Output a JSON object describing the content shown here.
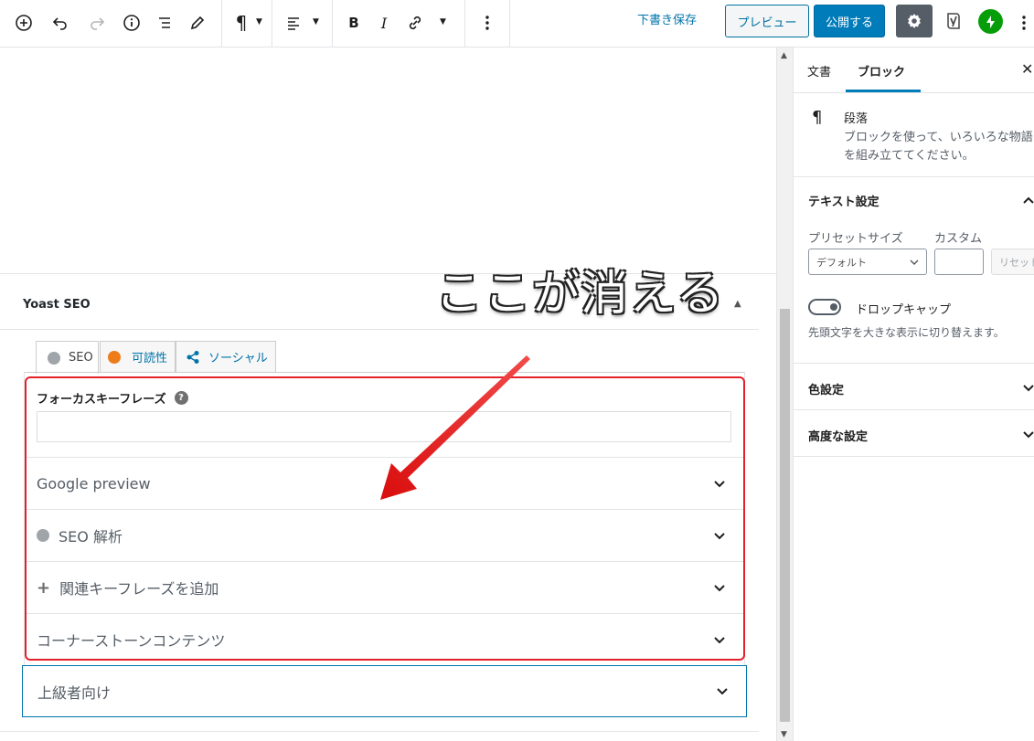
{
  "toolbar": {
    "icons": [
      "add-block-icon",
      "undo-icon",
      "redo-icon",
      "info-icon",
      "list-view-icon",
      "edit-icon",
      "paragraph-icon",
      "align-left-icon",
      "bold-icon",
      "italic-icon",
      "link-icon",
      "more-options-icon"
    ],
    "bold_glyph": "B",
    "italic_glyph": "I",
    "draft_label": "下書き保存",
    "preview_label": "プレビュー",
    "publish_label": "公開する"
  },
  "editor": {
    "annotation_text": "ここが消える",
    "yoast": {
      "title": "Yoast SEO",
      "tabs": [
        {
          "label": "SEO",
          "icon": "gray-dot-icon"
        },
        {
          "label": "可読性",
          "icon": "orange-face-icon"
        },
        {
          "label": "ソーシャル",
          "icon": "share-icon"
        }
      ],
      "focus_keyphrase_label": "フォーカスキーフレーズ",
      "focus_keyphrase_value": "",
      "help_glyph": "?",
      "sections": [
        {
          "label": "Google preview"
        },
        {
          "label": "SEO 解析"
        },
        {
          "label": "関連キーフレーズを追加"
        },
        {
          "label": "コーナーストーンコンテンツ"
        }
      ],
      "advanced_label": "上級者向け"
    }
  },
  "sidebar": {
    "tabs": [
      {
        "label": "文書",
        "active": false
      },
      {
        "label": "ブロック",
        "active": true
      }
    ],
    "close_glyph": "✕",
    "block": {
      "icon_glyph": "¶",
      "name": "段落",
      "description": "ブロックを使って、いろいろな物語\nを組み立ててください。"
    },
    "text_settings": {
      "title": "テキスト設定",
      "preset_label": "プリセットサイズ",
      "custom_label": "カスタム",
      "preset_value": "デフォルト",
      "custom_value": "",
      "reset_label": "リセット",
      "dropcap_label": "ドロップキャップ",
      "dropcap_help": "先頭文字を大きな表示に切り替えます。"
    },
    "color_settings_title": "色設定",
    "advanced_title": "高度な設定"
  },
  "colors": {
    "accent": "#007cba",
    "annotation_red": "#e5202a",
    "jetpack_green": "#069e08"
  }
}
